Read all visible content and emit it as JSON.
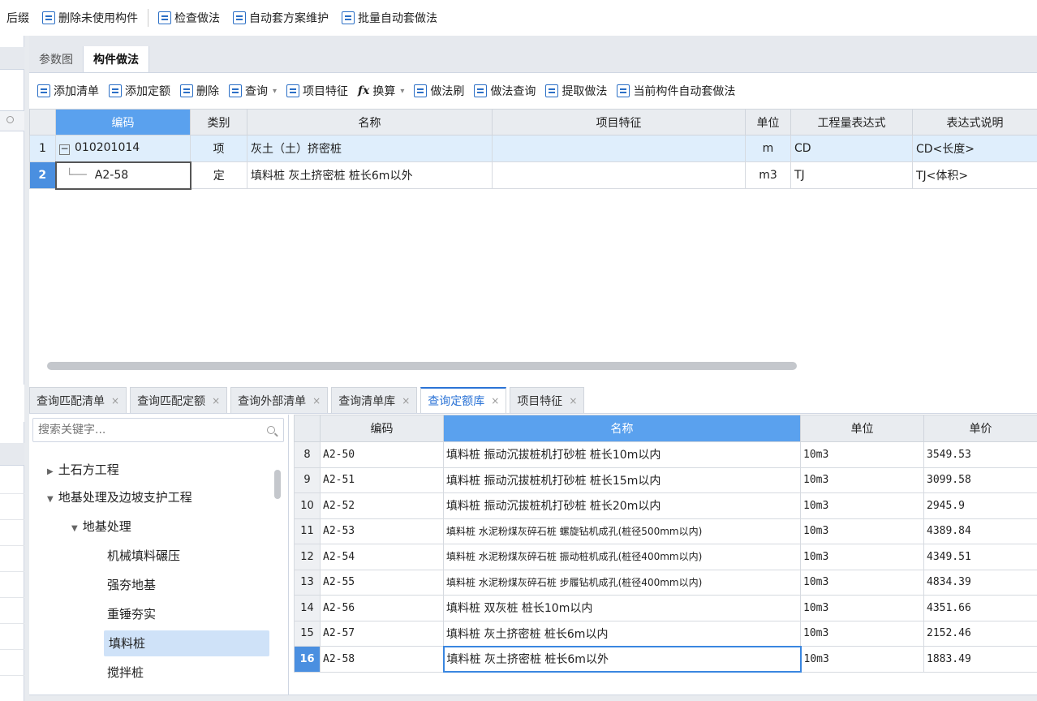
{
  "top_toolbar": {
    "items": [
      {
        "label": "后缀"
      },
      {
        "label": "删除未使用构件"
      },
      {
        "label": "检查做法"
      },
      {
        "label": "自动套方案维护"
      },
      {
        "label": "批量自动套做法"
      }
    ]
  },
  "upper_tabs": [
    {
      "label": "参数图"
    },
    {
      "label": "构件做法"
    }
  ],
  "upper_toolbar": {
    "items": [
      {
        "label": "添加清单"
      },
      {
        "label": "添加定额"
      },
      {
        "label": "删除"
      },
      {
        "label": "查询"
      },
      {
        "label": "项目特征"
      },
      {
        "label": "换算"
      },
      {
        "label": "做法刷"
      },
      {
        "label": "做法查询"
      },
      {
        "label": "提取做法"
      },
      {
        "label": "当前构件自动套做法"
      }
    ]
  },
  "upper_table": {
    "headers": [
      "编码",
      "类别",
      "名称",
      "项目特征",
      "单位",
      "工程量表达式",
      "表达式说明"
    ],
    "rows": [
      {
        "num": "1",
        "code": "010201014",
        "type": "项",
        "name": "灰土（土）挤密桩",
        "feature": "",
        "unit": "m",
        "expr": "CD",
        "desc": "CD<长度>"
      },
      {
        "num": "2",
        "code": "A2-58",
        "type": "定",
        "name": "填料桩 灰土挤密桩 桩长6m以外",
        "feature": "",
        "unit": "m3",
        "expr": "TJ",
        "desc": "TJ<体积>"
      }
    ]
  },
  "lower_tabs": [
    {
      "label": "查询匹配清单"
    },
    {
      "label": "查询匹配定额"
    },
    {
      "label": "查询外部清单"
    },
    {
      "label": "查询清单库"
    },
    {
      "label": "查询定额库"
    },
    {
      "label": "项目特征"
    }
  ],
  "search": {
    "placeholder": "搜索关键字..."
  },
  "tree": [
    {
      "label": "土石方工程"
    },
    {
      "label": "地基处理及边坡支护工程"
    },
    {
      "label": "地基处理"
    },
    {
      "label": "机械填料碾压"
    },
    {
      "label": "强夯地基"
    },
    {
      "label": "重锤夯实"
    },
    {
      "label": "填料桩"
    },
    {
      "label": "搅拌桩"
    }
  ],
  "quota_table": {
    "headers": [
      "编码",
      "名称",
      "单位",
      "单价"
    ],
    "rows": [
      {
        "num": "8",
        "code": "A2-50",
        "name": "填料桩 振动沉拔桩机打砂桩 桩长10m以内",
        "unit": "10m3",
        "price": "3549.53"
      },
      {
        "num": "9",
        "code": "A2-51",
        "name": "填料桩 振动沉拔桩机打砂桩 桩长15m以内",
        "unit": "10m3",
        "price": "3099.58"
      },
      {
        "num": "10",
        "code": "A2-52",
        "name": "填料桩 振动沉拔桩机打砂桩 桩长20m以内",
        "unit": "10m3",
        "price": "2945.9"
      },
      {
        "num": "11",
        "code": "A2-53",
        "name": "填料桩 水泥粉煤灰碎石桩 螺旋钻机成孔(桩径500mm以内)",
        "unit": "10m3",
        "price": "4389.84"
      },
      {
        "num": "12",
        "code": "A2-54",
        "name": "填料桩 水泥粉煤灰碎石桩 振动桩机成孔(桩径400mm以内)",
        "unit": "10m3",
        "price": "4349.51"
      },
      {
        "num": "13",
        "code": "A2-55",
        "name": "填料桩 水泥粉煤灰碎石桩 步履钻机成孔(桩径400mm以内)",
        "unit": "10m3",
        "price": "4834.39"
      },
      {
        "num": "14",
        "code": "A2-56",
        "name": "填料桩 双灰桩 桩长10m以内",
        "unit": "10m3",
        "price": "4351.66"
      },
      {
        "num": "15",
        "code": "A2-57",
        "name": "填料桩 灰土挤密桩 桩长6m以内",
        "unit": "10m3",
        "price": "2152.46"
      },
      {
        "num": "16",
        "code": "A2-58",
        "name": "填料桩 灰土挤密桩 桩长6m以外",
        "unit": "10m3",
        "price": "1883.49"
      }
    ]
  },
  "colors": {
    "accent": "#2b73d6",
    "header_selected": "#5aa1ee",
    "row_selected": "#dfeefc",
    "tree_selected": "#cfe2f8"
  }
}
